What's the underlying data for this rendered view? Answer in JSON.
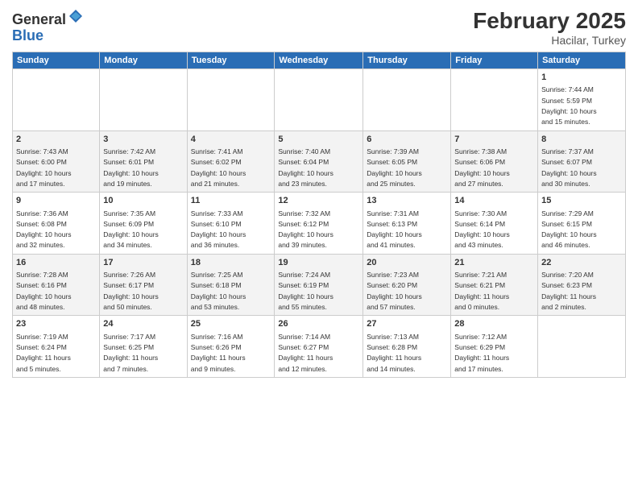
{
  "logo": {
    "general": "General",
    "blue": "Blue"
  },
  "title": {
    "month": "February 2025",
    "location": "Hacilar, Turkey"
  },
  "headers": [
    "Sunday",
    "Monday",
    "Tuesday",
    "Wednesday",
    "Thursday",
    "Friday",
    "Saturday"
  ],
  "weeks": [
    [
      {
        "day": "",
        "info": ""
      },
      {
        "day": "",
        "info": ""
      },
      {
        "day": "",
        "info": ""
      },
      {
        "day": "",
        "info": ""
      },
      {
        "day": "",
        "info": ""
      },
      {
        "day": "",
        "info": ""
      },
      {
        "day": "1",
        "info": "Sunrise: 7:44 AM\nSunset: 5:59 PM\nDaylight: 10 hours\nand 15 minutes."
      }
    ],
    [
      {
        "day": "2",
        "info": "Sunrise: 7:43 AM\nSunset: 6:00 PM\nDaylight: 10 hours\nand 17 minutes."
      },
      {
        "day": "3",
        "info": "Sunrise: 7:42 AM\nSunset: 6:01 PM\nDaylight: 10 hours\nand 19 minutes."
      },
      {
        "day": "4",
        "info": "Sunrise: 7:41 AM\nSunset: 6:02 PM\nDaylight: 10 hours\nand 21 minutes."
      },
      {
        "day": "5",
        "info": "Sunrise: 7:40 AM\nSunset: 6:04 PM\nDaylight: 10 hours\nand 23 minutes."
      },
      {
        "day": "6",
        "info": "Sunrise: 7:39 AM\nSunset: 6:05 PM\nDaylight: 10 hours\nand 25 minutes."
      },
      {
        "day": "7",
        "info": "Sunrise: 7:38 AM\nSunset: 6:06 PM\nDaylight: 10 hours\nand 27 minutes."
      },
      {
        "day": "8",
        "info": "Sunrise: 7:37 AM\nSunset: 6:07 PM\nDaylight: 10 hours\nand 30 minutes."
      }
    ],
    [
      {
        "day": "9",
        "info": "Sunrise: 7:36 AM\nSunset: 6:08 PM\nDaylight: 10 hours\nand 32 minutes."
      },
      {
        "day": "10",
        "info": "Sunrise: 7:35 AM\nSunset: 6:09 PM\nDaylight: 10 hours\nand 34 minutes."
      },
      {
        "day": "11",
        "info": "Sunrise: 7:33 AM\nSunset: 6:10 PM\nDaylight: 10 hours\nand 36 minutes."
      },
      {
        "day": "12",
        "info": "Sunrise: 7:32 AM\nSunset: 6:12 PM\nDaylight: 10 hours\nand 39 minutes."
      },
      {
        "day": "13",
        "info": "Sunrise: 7:31 AM\nSunset: 6:13 PM\nDaylight: 10 hours\nand 41 minutes."
      },
      {
        "day": "14",
        "info": "Sunrise: 7:30 AM\nSunset: 6:14 PM\nDaylight: 10 hours\nand 43 minutes."
      },
      {
        "day": "15",
        "info": "Sunrise: 7:29 AM\nSunset: 6:15 PM\nDaylight: 10 hours\nand 46 minutes."
      }
    ],
    [
      {
        "day": "16",
        "info": "Sunrise: 7:28 AM\nSunset: 6:16 PM\nDaylight: 10 hours\nand 48 minutes."
      },
      {
        "day": "17",
        "info": "Sunrise: 7:26 AM\nSunset: 6:17 PM\nDaylight: 10 hours\nand 50 minutes."
      },
      {
        "day": "18",
        "info": "Sunrise: 7:25 AM\nSunset: 6:18 PM\nDaylight: 10 hours\nand 53 minutes."
      },
      {
        "day": "19",
        "info": "Sunrise: 7:24 AM\nSunset: 6:19 PM\nDaylight: 10 hours\nand 55 minutes."
      },
      {
        "day": "20",
        "info": "Sunrise: 7:23 AM\nSunset: 6:20 PM\nDaylight: 10 hours\nand 57 minutes."
      },
      {
        "day": "21",
        "info": "Sunrise: 7:21 AM\nSunset: 6:21 PM\nDaylight: 11 hours\nand 0 minutes."
      },
      {
        "day": "22",
        "info": "Sunrise: 7:20 AM\nSunset: 6:23 PM\nDaylight: 11 hours\nand 2 minutes."
      }
    ],
    [
      {
        "day": "23",
        "info": "Sunrise: 7:19 AM\nSunset: 6:24 PM\nDaylight: 11 hours\nand 5 minutes."
      },
      {
        "day": "24",
        "info": "Sunrise: 7:17 AM\nSunset: 6:25 PM\nDaylight: 11 hours\nand 7 minutes."
      },
      {
        "day": "25",
        "info": "Sunrise: 7:16 AM\nSunset: 6:26 PM\nDaylight: 11 hours\nand 9 minutes."
      },
      {
        "day": "26",
        "info": "Sunrise: 7:14 AM\nSunset: 6:27 PM\nDaylight: 11 hours\nand 12 minutes."
      },
      {
        "day": "27",
        "info": "Sunrise: 7:13 AM\nSunset: 6:28 PM\nDaylight: 11 hours\nand 14 minutes."
      },
      {
        "day": "28",
        "info": "Sunrise: 7:12 AM\nSunset: 6:29 PM\nDaylight: 11 hours\nand 17 minutes."
      },
      {
        "day": "",
        "info": ""
      }
    ]
  ]
}
